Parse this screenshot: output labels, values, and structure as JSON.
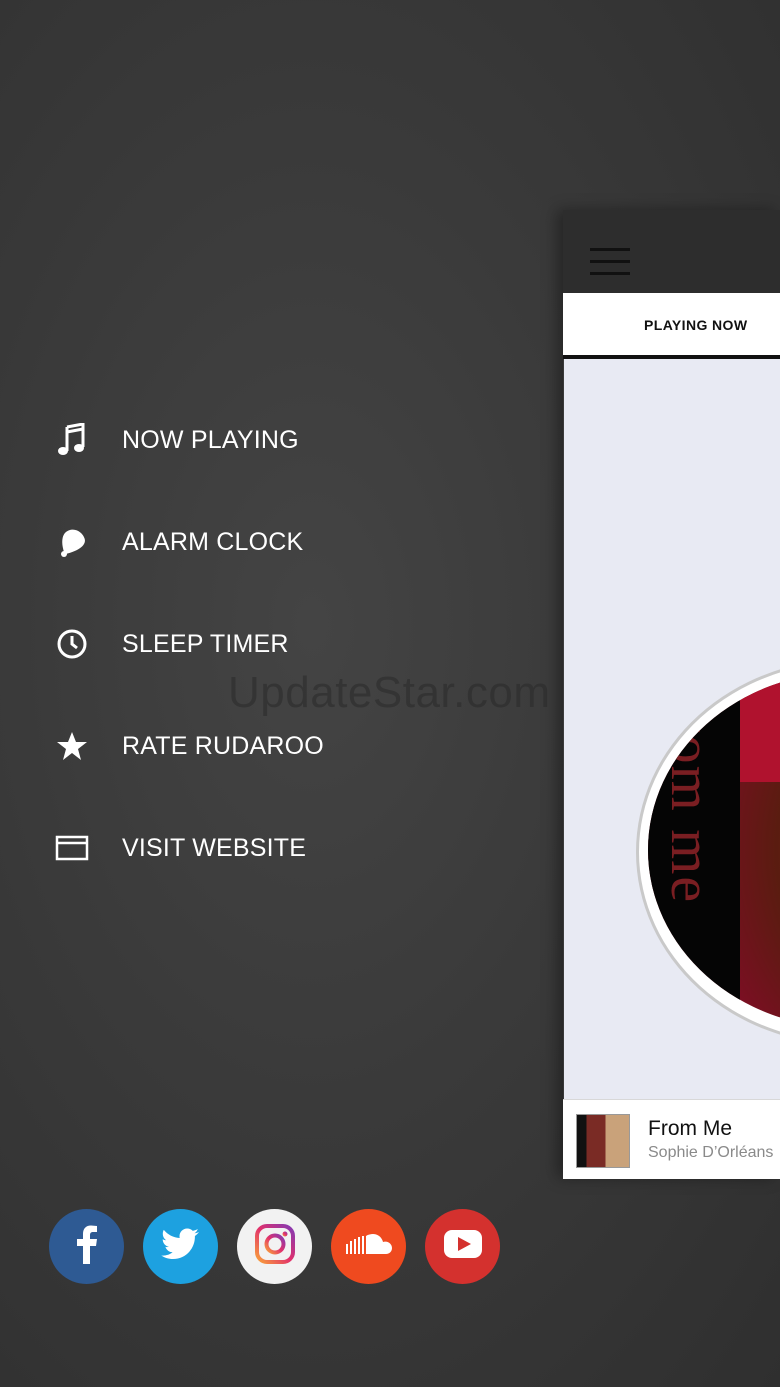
{
  "menu": {
    "items": [
      {
        "label": "NOW PLAYING",
        "icon": "music-note-icon"
      },
      {
        "label": "ALARM CLOCK",
        "icon": "bell-icon"
      },
      {
        "label": "SLEEP TIMER",
        "icon": "clock-icon"
      },
      {
        "label": "RATE RUDAROO",
        "icon": "star-icon"
      },
      {
        "label": "VISIT WEBSITE",
        "icon": "browser-window-icon"
      }
    ]
  },
  "watermark": "UpdateStar.com",
  "social": {
    "buttons": [
      {
        "name": "facebook",
        "icon": "facebook-icon",
        "color": "#2e5a93"
      },
      {
        "name": "twitter",
        "icon": "twitter-icon",
        "color": "#1da1e0"
      },
      {
        "name": "instagram",
        "icon": "instagram-icon",
        "color": "#f2f2f2"
      },
      {
        "name": "soundcloud",
        "icon": "soundcloud-icon",
        "color": "#ef4a1f"
      },
      {
        "name": "youtube",
        "icon": "youtube-icon",
        "color": "#d4312e"
      }
    ]
  },
  "panel": {
    "tab_label": "PLAYING NOW",
    "album_art_text": "from me",
    "now_playing": {
      "title": "From Me",
      "artist": "Sophie D’Orléans"
    }
  }
}
